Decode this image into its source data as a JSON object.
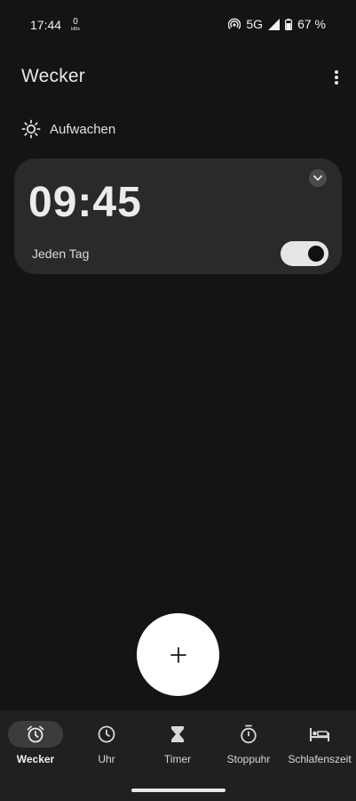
{
  "status_bar": {
    "time": "17:44",
    "net_speed_value": "0",
    "net_speed_unit": "kB/s",
    "network": "5G",
    "battery": "67 %"
  },
  "header": {
    "title": "Wecker"
  },
  "section": {
    "label": "Aufwachen",
    "icon": "sun-icon"
  },
  "alarm": {
    "time": "09:45",
    "repeat": "Jeden Tag",
    "enabled": true
  },
  "fab": {
    "icon": "plus-icon"
  },
  "nav": {
    "items": [
      {
        "label": "Wecker",
        "icon": "alarm-clock-icon",
        "active": true
      },
      {
        "label": "Uhr",
        "icon": "clock-icon",
        "active": false
      },
      {
        "label": "Timer",
        "icon": "hourglass-icon",
        "active": false
      },
      {
        "label": "Stoppuhr",
        "icon": "stopwatch-icon",
        "active": false
      },
      {
        "label": "Schlafenszeit",
        "icon": "bed-icon",
        "active": false
      }
    ]
  },
  "colors": {
    "background": "#141414",
    "card": "#2a2a2a",
    "nav_background": "#202020",
    "active_pill": "#3c3c3c",
    "fab": "#ffffff"
  }
}
